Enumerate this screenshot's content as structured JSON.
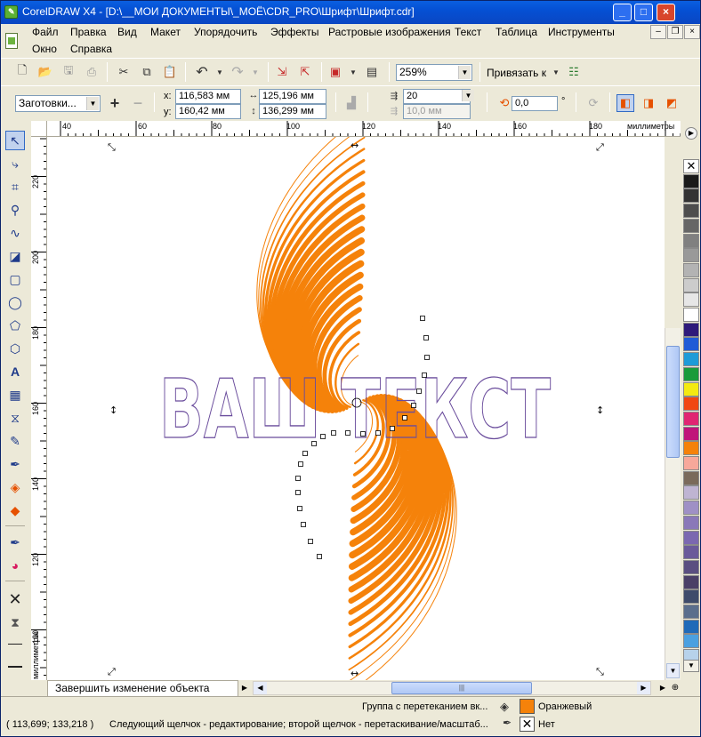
{
  "window": {
    "title": "CorelDRAW X4 - [D:\\__МОИ ДОКУМЕНТЫ\\_МОЁ\\CDR_PRO\\Шрифт\\Шрифт.cdr]"
  },
  "menu": {
    "items": [
      "Файл",
      "Правка",
      "Вид",
      "Макет",
      "Упорядочить",
      "Эффекты",
      "Растровые изображения",
      "Текст",
      "Таблица",
      "Инструменты"
    ],
    "items2": [
      "Окно",
      "Справка"
    ]
  },
  "standard_toolbar": {
    "zoom": "259%",
    "snap_label": "Привязать к"
  },
  "property_bar": {
    "preset": "Заготовки...",
    "x_label": "x:",
    "x_value": "116,583 мм",
    "y_label": "y:",
    "y_value": "160,42 мм",
    "width": "125,196 мм",
    "height": "136,299 мм",
    "steps": "20",
    "spacing": "10,0 мм",
    "rotation": "0,0",
    "deg": "°"
  },
  "ruler": {
    "units": "миллиметры",
    "h_ticks": [
      "40",
      "60",
      "80",
      "100",
      "120",
      "140",
      "160",
      "180"
    ],
    "v_ticks": [
      "220",
      "200",
      "180",
      "160",
      "140",
      "120",
      "100"
    ],
    "v_units": "миллиметры"
  },
  "canvas": {
    "text": "ВАШ ТЕКСТ",
    "stroke_color": "#f5820a",
    "outline_color": "#6a4c9c"
  },
  "tab": {
    "label": "Завершить изменение объекта"
  },
  "status": {
    "coords": "( 113,699; 133,218 )",
    "hint": "Следующий щелчок - редактирование; второй щелчок - перетаскивание/масштаб...",
    "object": "Группа с перетеканием вк...",
    "fill_name": "Оранжевый",
    "fill_color": "#f5820a",
    "outline_name": "Нет"
  },
  "palette": [
    "#fff",
    "#1a1a1a",
    "#333",
    "#4d4d4d",
    "#666",
    "#808080",
    "#999",
    "#b3b3b3",
    "#ccc",
    "#e6e6e6",
    "#fff",
    "#2e1a7a",
    "#1f5bd6",
    "#1e9bd7",
    "#199b3a",
    "#f4ea11",
    "#f14712",
    "#e02572",
    "#c0147a",
    "#f5820a",
    "#f7a89a",
    "#7a6a5a",
    "#bfb4d2",
    "#9f90c5",
    "#8a78b8",
    "#7b68b0",
    "#6a5a9a",
    "#5a4e80",
    "#4a3f66",
    "#3e4b6a",
    "#5a6e8c",
    "#1e6ab8",
    "#4aa0e0",
    "#b7d2ea"
  ]
}
